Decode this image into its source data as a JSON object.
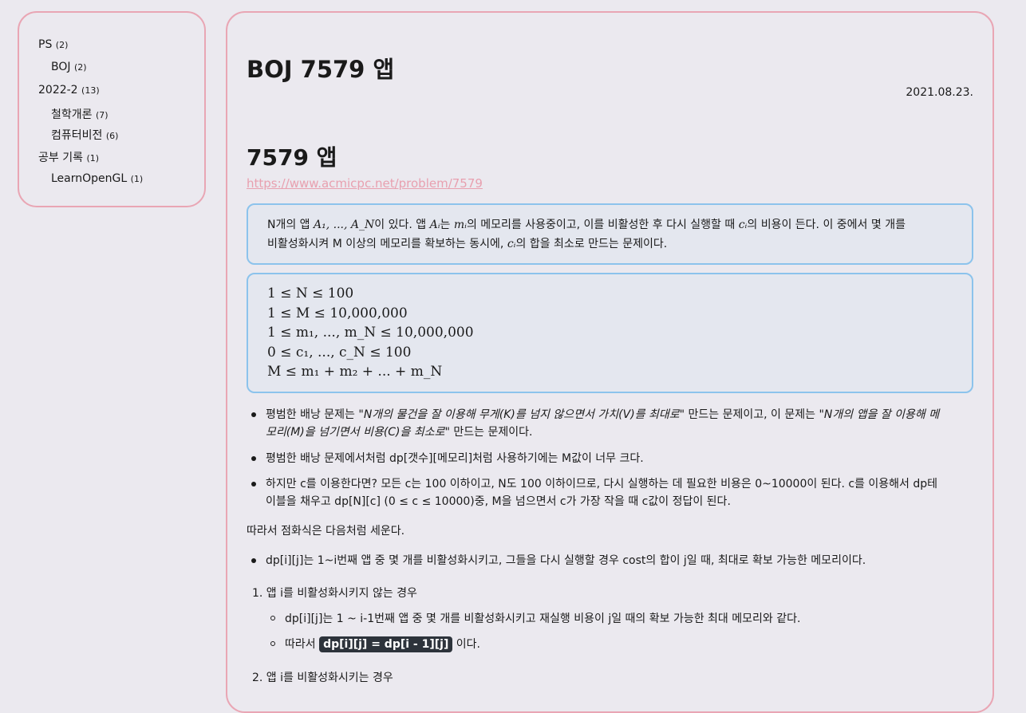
{
  "sidebar": {
    "categories": [
      {
        "name": "PS",
        "count": "(2)"
      },
      {
        "name": "BOJ",
        "count": "(2)"
      },
      {
        "name": "2022-2",
        "count": "(13)"
      },
      {
        "name": "철학개론",
        "count": "(7)"
      },
      {
        "name": "컴퓨터비전",
        "count": "(6)"
      },
      {
        "name": "공부 기록",
        "count": "(1)"
      },
      {
        "name": "LearnOpenGL",
        "count": "(1)"
      }
    ]
  },
  "post": {
    "title": "BOJ 7579 앱",
    "date": "2021.08.23.",
    "heading": "7579 앱",
    "link": "https://www.acmicpc.net/problem/7579",
    "desc": {
      "p1": "N개의 앱 ",
      "m1": "A₁, ..., A_N",
      "p2": "이 있다. 앱 ",
      "m2": "Aᵢ",
      "p3": "는 ",
      "m3": "mᵢ",
      "p4": "의 메모리를 사용중이고, 이를 비활성한 후 다시 실행할 때 ",
      "m4": "cᵢ",
      "p5": "의 비용이 든다. 이 중에서 몇 개를",
      "p6": "비활성화시켜 M 이상의 메모리를 확보하는 동시에, ",
      "m5": "cᵢ",
      "p7": "의 합을 최소로 만드는 문제이다."
    },
    "constraints": [
      "1 ≤ N ≤ 100",
      "1 ≤ M ≤ 10,000,000",
      "1 ≤ m₁, ..., m_N ≤ 10,000,000",
      "0 ≤ c₁, ..., c_N ≤ 100",
      "M ≤ m₁ + m₂ + ... + m_N"
    ],
    "bullet1": {
      "a": "평범한 배낭 문제는 ",
      "b": "\"N개의 물건을 잘 이용해 무게(K)를 넘지 않으면서 가치(V)를 최대로\"",
      "c": " 만드는 문제이고, 이 문제는 ",
      "d": "\"N개의 앱을 잘 이용해 메",
      "e": "모리(M)을 넘기면서 비용(C)을 최소로\"",
      "f": " 만드는 문제이다."
    },
    "bullet2": "평범한 배낭 문제에서처럼 dp[갯수][메모리]처럼 사용하기에는 M값이 너무 크다.",
    "bullet3": {
      "line1": "하지만 c를 이용한다면? 모든 c는 100 이하이고, N도 100 이하이므로, 다시 실행하는 데 필요한 비용은 0~10000이 된다. c를 이용해서 dp테",
      "line2": "이블을 채우고 dp[N][c] (0 ≤ c ≤ 10000)중, M을 넘으면서 c가 가장 작을 때 c값이 정답이 된다."
    },
    "para": "따라서 점화식은 다음처럼 세운다.",
    "bullet4": "dp[i][j]는 1~i번째 앱 중 몇 개를 비활성화시키고, 그들을 다시 실행할 경우 cost의 합이 j일 때, 최대로 확보 가능한 메모리이다.",
    "ol1": "1. 앱 i를 비활성화시키지 않는 경우",
    "sub1": "dp[i][j]는 1 ~ i-1번째 앱 중 몇 개를 비활성화시키고 재실행 비용이 j일 때의 확보 가능한 최대 메모리와 같다.",
    "sub2_prefix": "따라서 ",
    "sub2_code": "dp[i][j] = dp[i - 1][j]",
    "sub2_suffix": " 이다.",
    "ol2": "2. 앱 i를 비활성화시키는 경우"
  }
}
